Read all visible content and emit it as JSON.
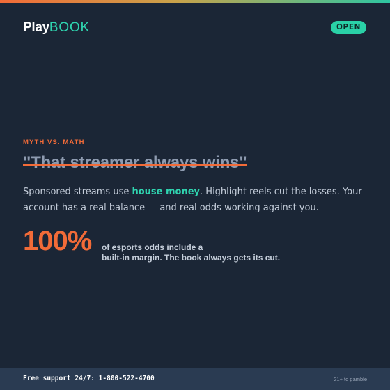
{
  "header": {
    "logo_play": "Play",
    "logo_book": "BOOK",
    "open_label": "OPEN"
  },
  "main": {
    "eyebrow": "MYTH VS. MATH",
    "myth_quote": "\"That streamer always wins\"",
    "body_pre": "Sponsored streams use ",
    "body_highlight": "house money",
    "body_post": ". Highlight reels cut the losses. Your account has a real balance — and real odds working against you.",
    "stat_value": "100%",
    "stat_caption_line1": "of esports odds include a",
    "stat_caption_line2": "built-in margin. The book always gets its cut."
  },
  "footer": {
    "support": "Free support 24/7: 1-800-522-4700",
    "age_notice": "21+ to gamble"
  },
  "colors": {
    "background": "#1b2636",
    "accent_orange": "#f26b38",
    "accent_teal": "#2fd5b0",
    "footer_background": "#2a3b52"
  }
}
